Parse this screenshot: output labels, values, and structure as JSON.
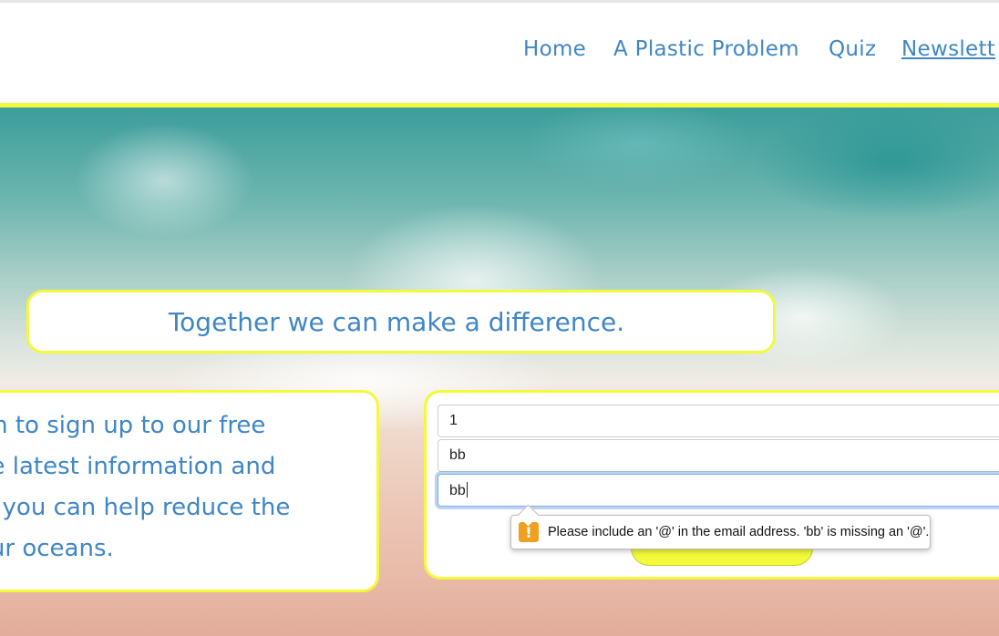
{
  "nav": {
    "items": [
      {
        "label": "Home"
      },
      {
        "label": "A Plastic Problem"
      },
      {
        "label": "Quiz"
      },
      {
        "label": "Newslett"
      }
    ],
    "active": "Newslett"
  },
  "banner": {
    "text": "Together we can make a difference."
  },
  "intro": {
    "lines": [
      "rm to sign up to our free",
      "he latest information and",
      "w you can help reduce the",
      "our oceans."
    ]
  },
  "form": {
    "fields": [
      {
        "value": "1"
      },
      {
        "value": "bb"
      },
      {
        "value": "bb"
      }
    ]
  },
  "validation": {
    "icon": "warning-icon",
    "icon_glyph": "!",
    "message": "Please include an '@' in the email address. 'bb' is missing an '@'."
  },
  "colors": {
    "accent_yellow": "#f2fa3a",
    "link_blue": "#3f86c6",
    "warning_orange": "#f0a020"
  }
}
